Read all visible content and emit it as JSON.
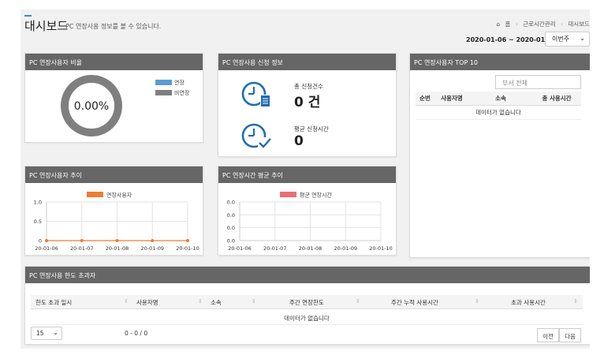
{
  "header": {
    "title": "대시보드",
    "subtitle": "PC 연장사용 정보를 볼 수 있습니다.",
    "breadcrumb": [
      "홈",
      "근로시간관리",
      "대시보드"
    ],
    "date_range": "2020-01-06 ~ 2020-01-10",
    "period_select": "이번주"
  },
  "ratio_panel": {
    "title": "PC 연장사용자 비율",
    "value_label": "0.00%",
    "legend": [
      {
        "label": "연장",
        "color": "#5b9bd5"
      },
      {
        "label": "비연장",
        "color": "#7f7f7f"
      }
    ],
    "extended_fraction": 0.0
  },
  "application_panel": {
    "title": "PC 연장사용 신청 정보",
    "total_label": "총 신청건수",
    "total_value": "0 건",
    "avg_label": "평균 신청시간",
    "avg_value": "0"
  },
  "top10_panel": {
    "title": "PC 연장사용자 TOP 10",
    "filter_value": "부서 전체",
    "columns": [
      "순번",
      "사용자명",
      "소속",
      "총 사용시간"
    ],
    "empty_text": "데이터가 없습니다"
  },
  "trend_users_panel": {
    "title": "PC 연장사용자 추이",
    "chart_data": {
      "type": "line",
      "x": [
        "20-01-06",
        "20-01-07",
        "20-01-08",
        "20-01-09",
        "20-01-10"
      ],
      "series": [
        {
          "name": "연장사용자",
          "values": [
            0,
            0,
            0,
            0,
            0
          ],
          "color": "#ed7d31"
        }
      ],
      "ylim": [
        0,
        1.0
      ],
      "yticks": [
        "0",
        "0.5",
        "1.0"
      ],
      "grid": true,
      "legend": "top"
    }
  },
  "trend_avg_panel": {
    "title": "PC 연장시간 평균 추이",
    "chart_data": {
      "type": "line",
      "x": [
        "20-01-06",
        "20-01-07",
        "20-01-08",
        "20-01-09",
        "20-01-10"
      ],
      "series": [
        {
          "name": "평균 연장시간",
          "values": [],
          "color": "#ec6e6e"
        }
      ],
      "yticks": [
        "0.0",
        "0.0",
        "0.0",
        "0.0"
      ],
      "grid": true,
      "legend": "top"
    }
  },
  "limit_panel": {
    "title": "PC 연장사용 한도 초과자",
    "columns": [
      "한도 초과 일시",
      "사용자명",
      "소속",
      "주간 연장한도",
      "주간 누적 사용시간",
      "초과 사용시간"
    ],
    "empty_text": "데이터가 없습니다",
    "page_size": "15",
    "pager_info": "0 - 0 / 0",
    "prev_label": "이전",
    "next_label": "다음"
  }
}
